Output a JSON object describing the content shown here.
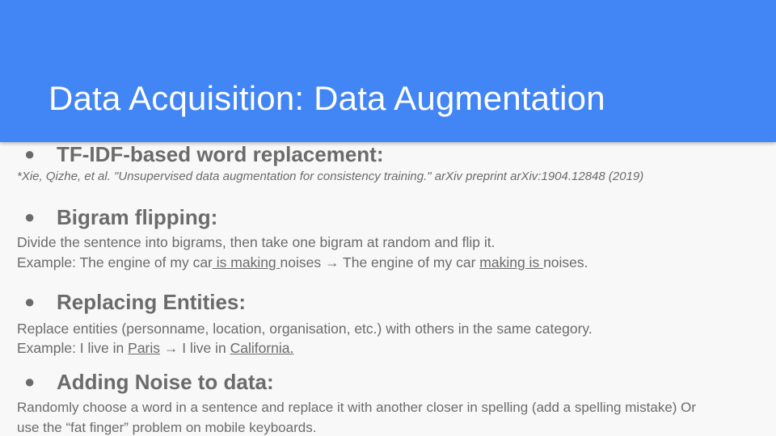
{
  "slide": {
    "title": "Data Acquisition: Data Augmentation",
    "accent_color": "#4285f4",
    "bullet_glyph": "●"
  },
  "sections": [
    {
      "heading": "TF-IDF-based word replacement:",
      "citation": "*Xie, Qizhe, et al. \"Unsupervised data augmentation for consistency training.\" arXiv preprint arXiv:1904.12848 (2019)"
    },
    {
      "heading": "Bigram flipping:",
      "line1": "Divide the sentence into bigrams, then take one bigram at random and flip it.",
      "ex_prefix": "Example: The engine of my car",
      "ex_u1": " is making ",
      "ex_mid": "noises → The engine of my car ",
      "ex_u2": "making is ",
      "ex_suffix": "noises."
    },
    {
      "heading": "Replacing Entities:",
      "line1": "Replace entities (personname, location, organisation, etc.) with others in the same category.",
      "ex_prefix": "Example: I live in ",
      "ex_u1": "Paris",
      "ex_mid": " → I live in ",
      "ex_u2": "California."
    },
    {
      "heading": "Adding Noise to data:",
      "line1": "Randomly choose a word in a sentence and replace it with another closer in spelling (add a spelling mistake) Or",
      "line2": "use the “fat finger” problem on mobile keyboards."
    }
  ]
}
